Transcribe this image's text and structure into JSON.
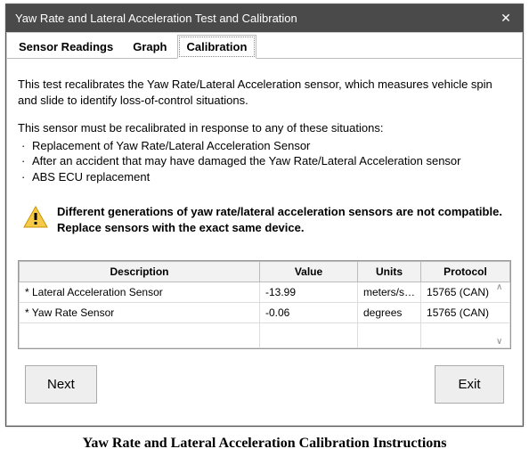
{
  "window": {
    "title": "Yaw Rate and Lateral Acceleration Test and Calibration",
    "close": "✕"
  },
  "tabs": {
    "t0": "Sensor Readings",
    "t1": "Graph",
    "t2": "Calibration"
  },
  "content": {
    "description": "This test recalibrates the Yaw Rate/Lateral Acceleration sensor, which measures vehicle spin and slide to identify loss-of-control situations.",
    "situations_intro": "This sensor must be recalibrated in response to any of these situations:",
    "situations": {
      "s0": "Replacement of Yaw Rate/Lateral Acceleration Sensor",
      "s1": "After an accident that may have damaged the Yaw Rate/Lateral Acceleration sensor",
      "s2": "ABS ECU replacement"
    },
    "warning": "Different generations of yaw rate/lateral acceleration sensors are not compatible. Replace sensors with the exact same device."
  },
  "table": {
    "headers": {
      "description": "Description",
      "value": "Value",
      "units": "Units",
      "protocol": "Protocol"
    },
    "rows": {
      "r0": {
        "description": "* Lateral Acceleration Sensor",
        "value": "-13.99",
        "units": "meters/s…",
        "protocol": "15765 (CAN)"
      },
      "r1": {
        "description": "* Yaw Rate Sensor",
        "value": "-0.06",
        "units": "degrees",
        "protocol": "15765 (CAN)"
      }
    }
  },
  "buttons": {
    "next": "Next",
    "exit": "Exit"
  },
  "caption": "Yaw Rate and Lateral Acceleration Calibration Instructions"
}
